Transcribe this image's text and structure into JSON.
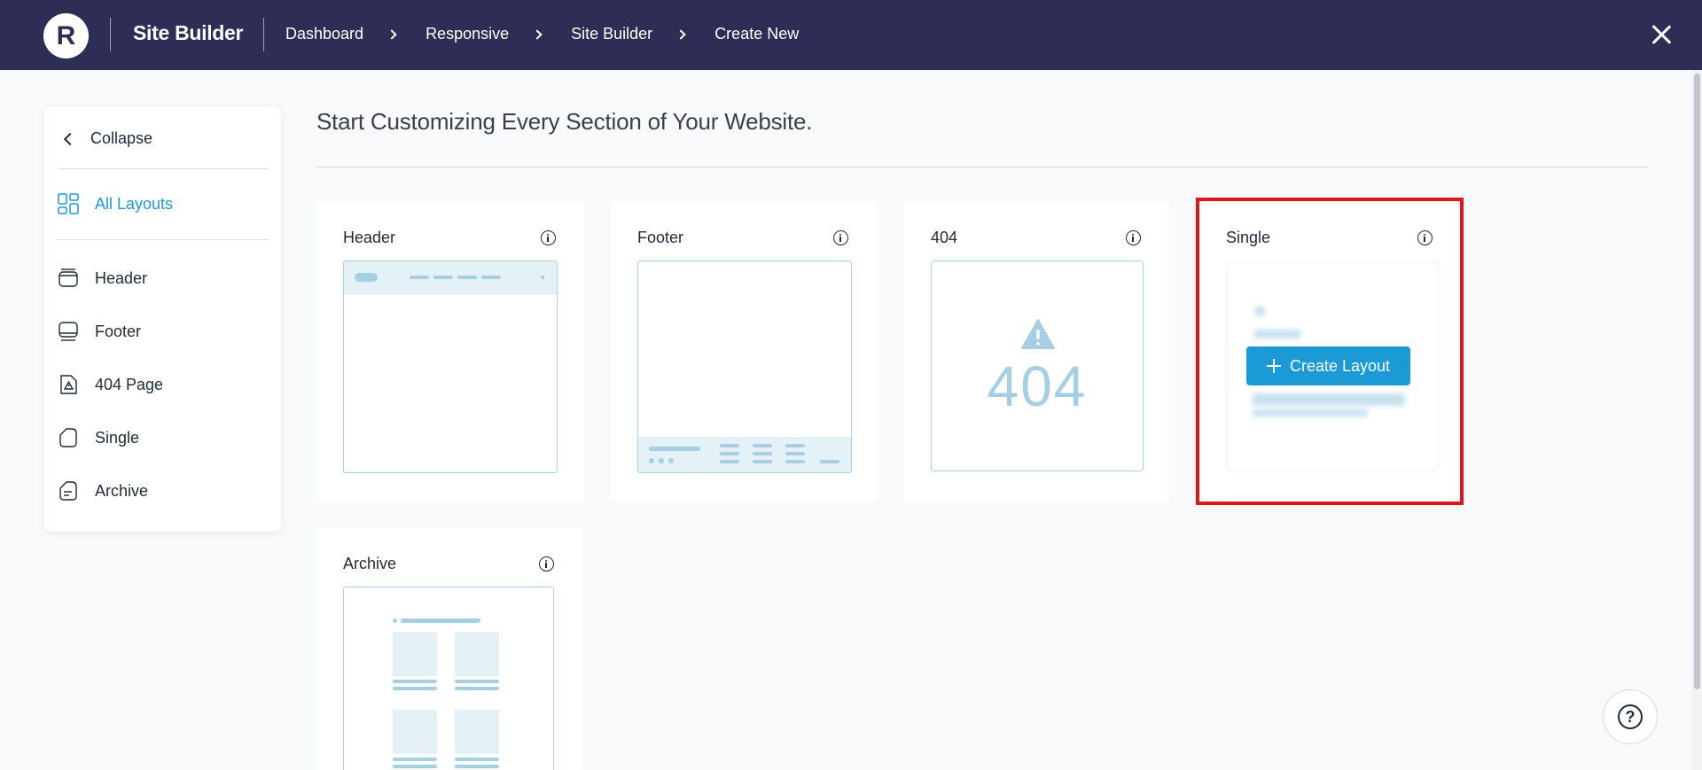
{
  "topbar": {
    "logo_letter": "R",
    "brand": "Site Builder",
    "breadcrumbs": [
      "Dashboard",
      "Responsive",
      "Site Builder",
      "Create New"
    ]
  },
  "sidebar": {
    "collapse_label": "Collapse",
    "all_layouts_label": "All Layouts",
    "items": [
      {
        "label": "Header",
        "icon": "header-layout-icon"
      },
      {
        "label": "Footer",
        "icon": "footer-layout-icon"
      },
      {
        "label": "404 Page",
        "icon": "error-page-icon"
      },
      {
        "label": "Single",
        "icon": "single-page-icon"
      },
      {
        "label": "Archive",
        "icon": "archive-page-icon"
      }
    ]
  },
  "main": {
    "title": "Start Customizing Every Section of Your Website.",
    "cards": [
      {
        "title": "Header"
      },
      {
        "title": "Footer"
      },
      {
        "title": "404",
        "preview_text": "404"
      },
      {
        "title": "Single",
        "button_label": "Create Layout"
      },
      {
        "title": "Archive"
      }
    ]
  },
  "help": {
    "symbol": "?"
  },
  "colors": {
    "topbar": "#2e2d55",
    "accent": "#1b9ad6",
    "highlight": "#e3141b",
    "preview_line": "#a7cfe3"
  }
}
